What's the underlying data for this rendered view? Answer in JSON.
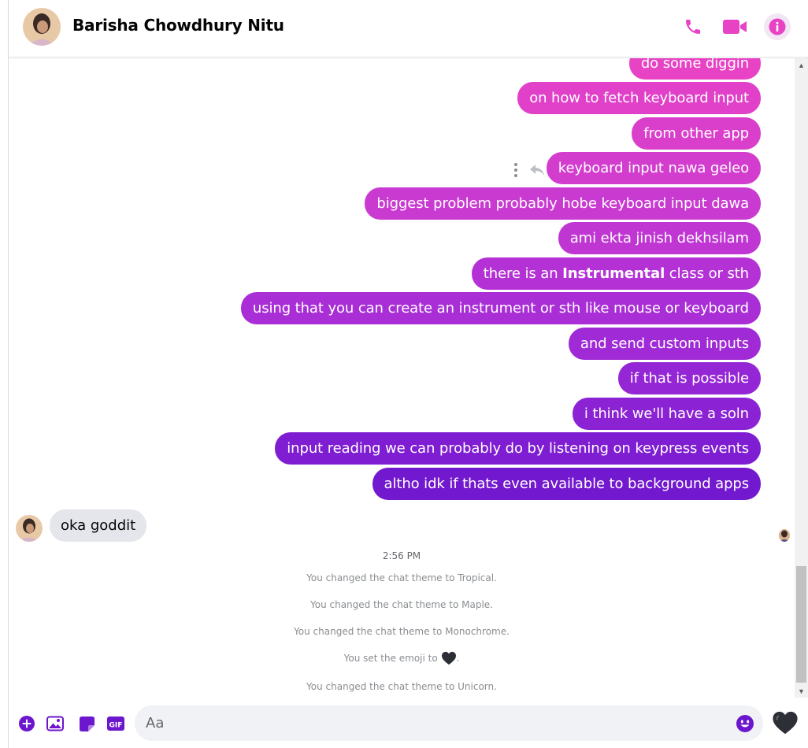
{
  "header": {
    "contact_name": "Barisha Chowdhury Nitu"
  },
  "colors": {
    "accent": "#e843c4",
    "bubble_gradient_top": "#e843c4",
    "bubble_gradient_bottom": "#6c16ce",
    "incoming_bubble": "#e4e6eb"
  },
  "messages": {
    "outgoing": [
      "do some diggin",
      "on how to fetch keyboard input",
      "from other app",
      "keyboard input nawa geleo",
      "biggest problem probably hobe keyboard input dawa",
      "ami ekta jinish dekhsilam",
      {
        "before": "there is an ",
        "bold": "Instrumental",
        "after": " class or sth"
      },
      "using that you can create an instrument or sth like mouse or keyboard",
      "and send custom inputs",
      "if that is possible",
      "i think we'll have a soln",
      "input reading we can probably do by listening on keypress events",
      "altho idk if thats even available to background apps"
    ],
    "incoming": "oka goddit",
    "timestamp": "2:56 PM",
    "system": [
      "You changed the chat theme to Tropical.",
      "You changed the chat theme to Maple.",
      "You changed the chat theme to Monochrome.",
      "You set the emoji to",
      "You changed the chat theme to Unicorn."
    ],
    "emoji_suffix": "."
  },
  "composer": {
    "placeholder": "Aa",
    "gif_label": "GIF"
  },
  "icons": {
    "header": [
      "phone-icon",
      "video-camera-icon",
      "info-icon"
    ],
    "composer": [
      "plus-circle-icon",
      "image-icon",
      "sticker-icon",
      "gif-icon",
      "emoji-icon",
      "black-heart-icon"
    ],
    "hover": [
      "more-icon",
      "reply-icon",
      "react-icon"
    ]
  }
}
